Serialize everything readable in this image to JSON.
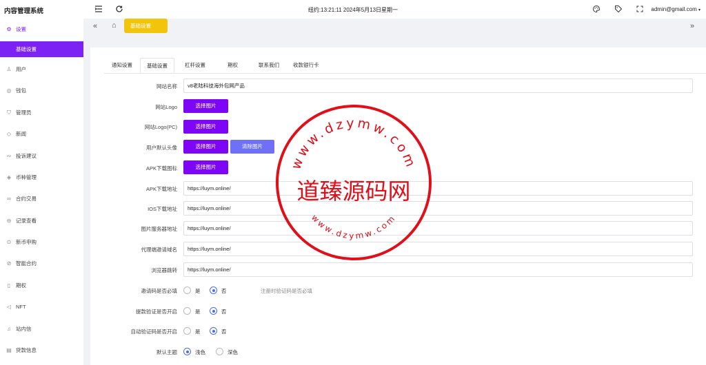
{
  "app": {
    "brand": "内容管理系统"
  },
  "header": {
    "clock": "纽约:13:21:11 2024年5月13日星期一",
    "user": "admin@gmail.com",
    "user_caret": "▾",
    "icons": [
      "menu-fold-icon",
      "refresh-icon",
      "palette-icon",
      "tag-icon",
      "fullscreen-icon"
    ]
  },
  "sidebar": {
    "items": [
      {
        "label": "设置",
        "icon": "gear-icon"
      },
      {
        "label": "用户",
        "icon": "user-icon"
      },
      {
        "label": "钱包",
        "icon": "wallet-icon"
      },
      {
        "label": "管理员",
        "icon": "shield-icon"
      },
      {
        "label": "新闻",
        "icon": "tag-icon"
      },
      {
        "label": "投诉建议",
        "icon": "handshake-icon"
      },
      {
        "label": "币种管理",
        "icon": "diamond-icon"
      },
      {
        "label": "合约交易",
        "icon": "link-icon"
      },
      {
        "label": "记录查看",
        "icon": "record-icon"
      },
      {
        "label": "新币申购",
        "icon": "coin-icon"
      },
      {
        "label": "智能合约",
        "icon": "contract-icon"
      },
      {
        "label": "期权",
        "icon": "option-icon"
      },
      {
        "label": "NFT",
        "icon": "nft-icon"
      },
      {
        "label": "站内信",
        "icon": "bell-icon"
      },
      {
        "label": "贷款信息",
        "icon": "loan-icon"
      }
    ],
    "active_sub": "基础设置"
  },
  "tagbar": {
    "active_tag": "基础设置"
  },
  "tabs": [
    "通知设置",
    "基础设置",
    "杠杆设置",
    "期权",
    "联系我们",
    "收款银行卡"
  ],
  "form": {
    "site_name_label": "网站名称",
    "site_name_value": "v8老陆科技海外包网产品",
    "logo_label": "网站Logo",
    "logo_pc_label": "网站Logo(PC)",
    "avatar_label": "用户默认头像",
    "apk_icon_label": "APK下载图标",
    "select_image": "选择图片",
    "clear_image": "清除图片",
    "apk_url_label": "APK下载地址",
    "apk_url_value": "https://luym.online/",
    "ios_url_label": "IOS下载地址",
    "ios_url_value": "https://luym.online/",
    "image_server_label": "图片服务器地址",
    "image_server_value": "https://luym.online/",
    "agent_domain_label": "代理端邀请域名",
    "agent_domain_value": "https://luym.online/",
    "browser_redirect_label": "浏览器跳转",
    "browser_redirect_value": "https://luym.online/",
    "invite_required_label": "邀请码是否必填",
    "invite_hint": "注册时验证码是否必填",
    "withdraw_verify_label": "提款验证是否开启",
    "auto_verify_label": "自动验证码是否开启",
    "theme_label": "默认主题",
    "yes": "是",
    "no": "否",
    "theme_light": "浅色",
    "theme_dark": "深色"
  },
  "watermark": {
    "text": "道臻源码网",
    "ring_top": "www.dzymw.com",
    "ring_bottom": "www.dzymw.com",
    "color": "#e0101a"
  }
}
